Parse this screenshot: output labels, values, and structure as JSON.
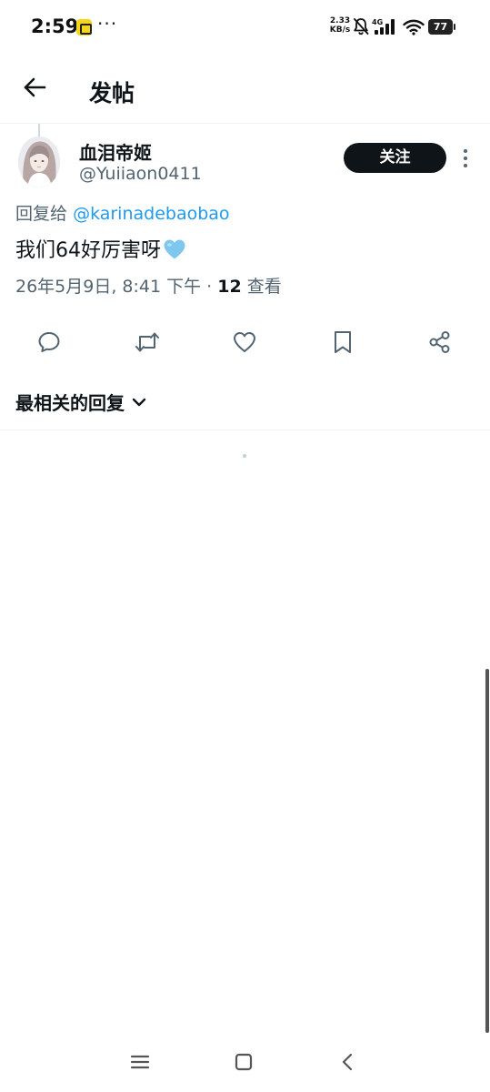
{
  "status_bar": {
    "time": "2:59",
    "more": "···",
    "net_speed_value": "2.33",
    "net_speed_unit": "KB/s",
    "network_type": "4G",
    "battery": "77"
  },
  "header": {
    "title": "发帖"
  },
  "post": {
    "display_name": "血泪帝姬",
    "username": "@Yuiiaon0411",
    "follow_label": "关注",
    "reply_prefix": "回复给",
    "reply_mention": "@karinadebaobao",
    "text": "我们64好厉害呀",
    "emoji": "🩵",
    "timestamp": "26年5月9日, 8:41 下午",
    "separator": " · ",
    "view_count": "12",
    "views_label": " 查看"
  },
  "replies": {
    "sort_label": "最相关的回复"
  },
  "colors": {
    "text_primary": "#0f1419",
    "text_secondary": "#536471",
    "accent": "#1d9bf0",
    "follow_bg": "#0f1419",
    "heart_emoji": "#7ec8ef"
  },
  "icons": {
    "back": "arrow-left-icon",
    "more": "more-vertical-icon",
    "reply": "comment-icon",
    "repost": "repost-icon",
    "like": "heart-icon",
    "bookmark": "bookmark-icon",
    "share": "share-icon",
    "sort": "chevron-down-icon"
  }
}
